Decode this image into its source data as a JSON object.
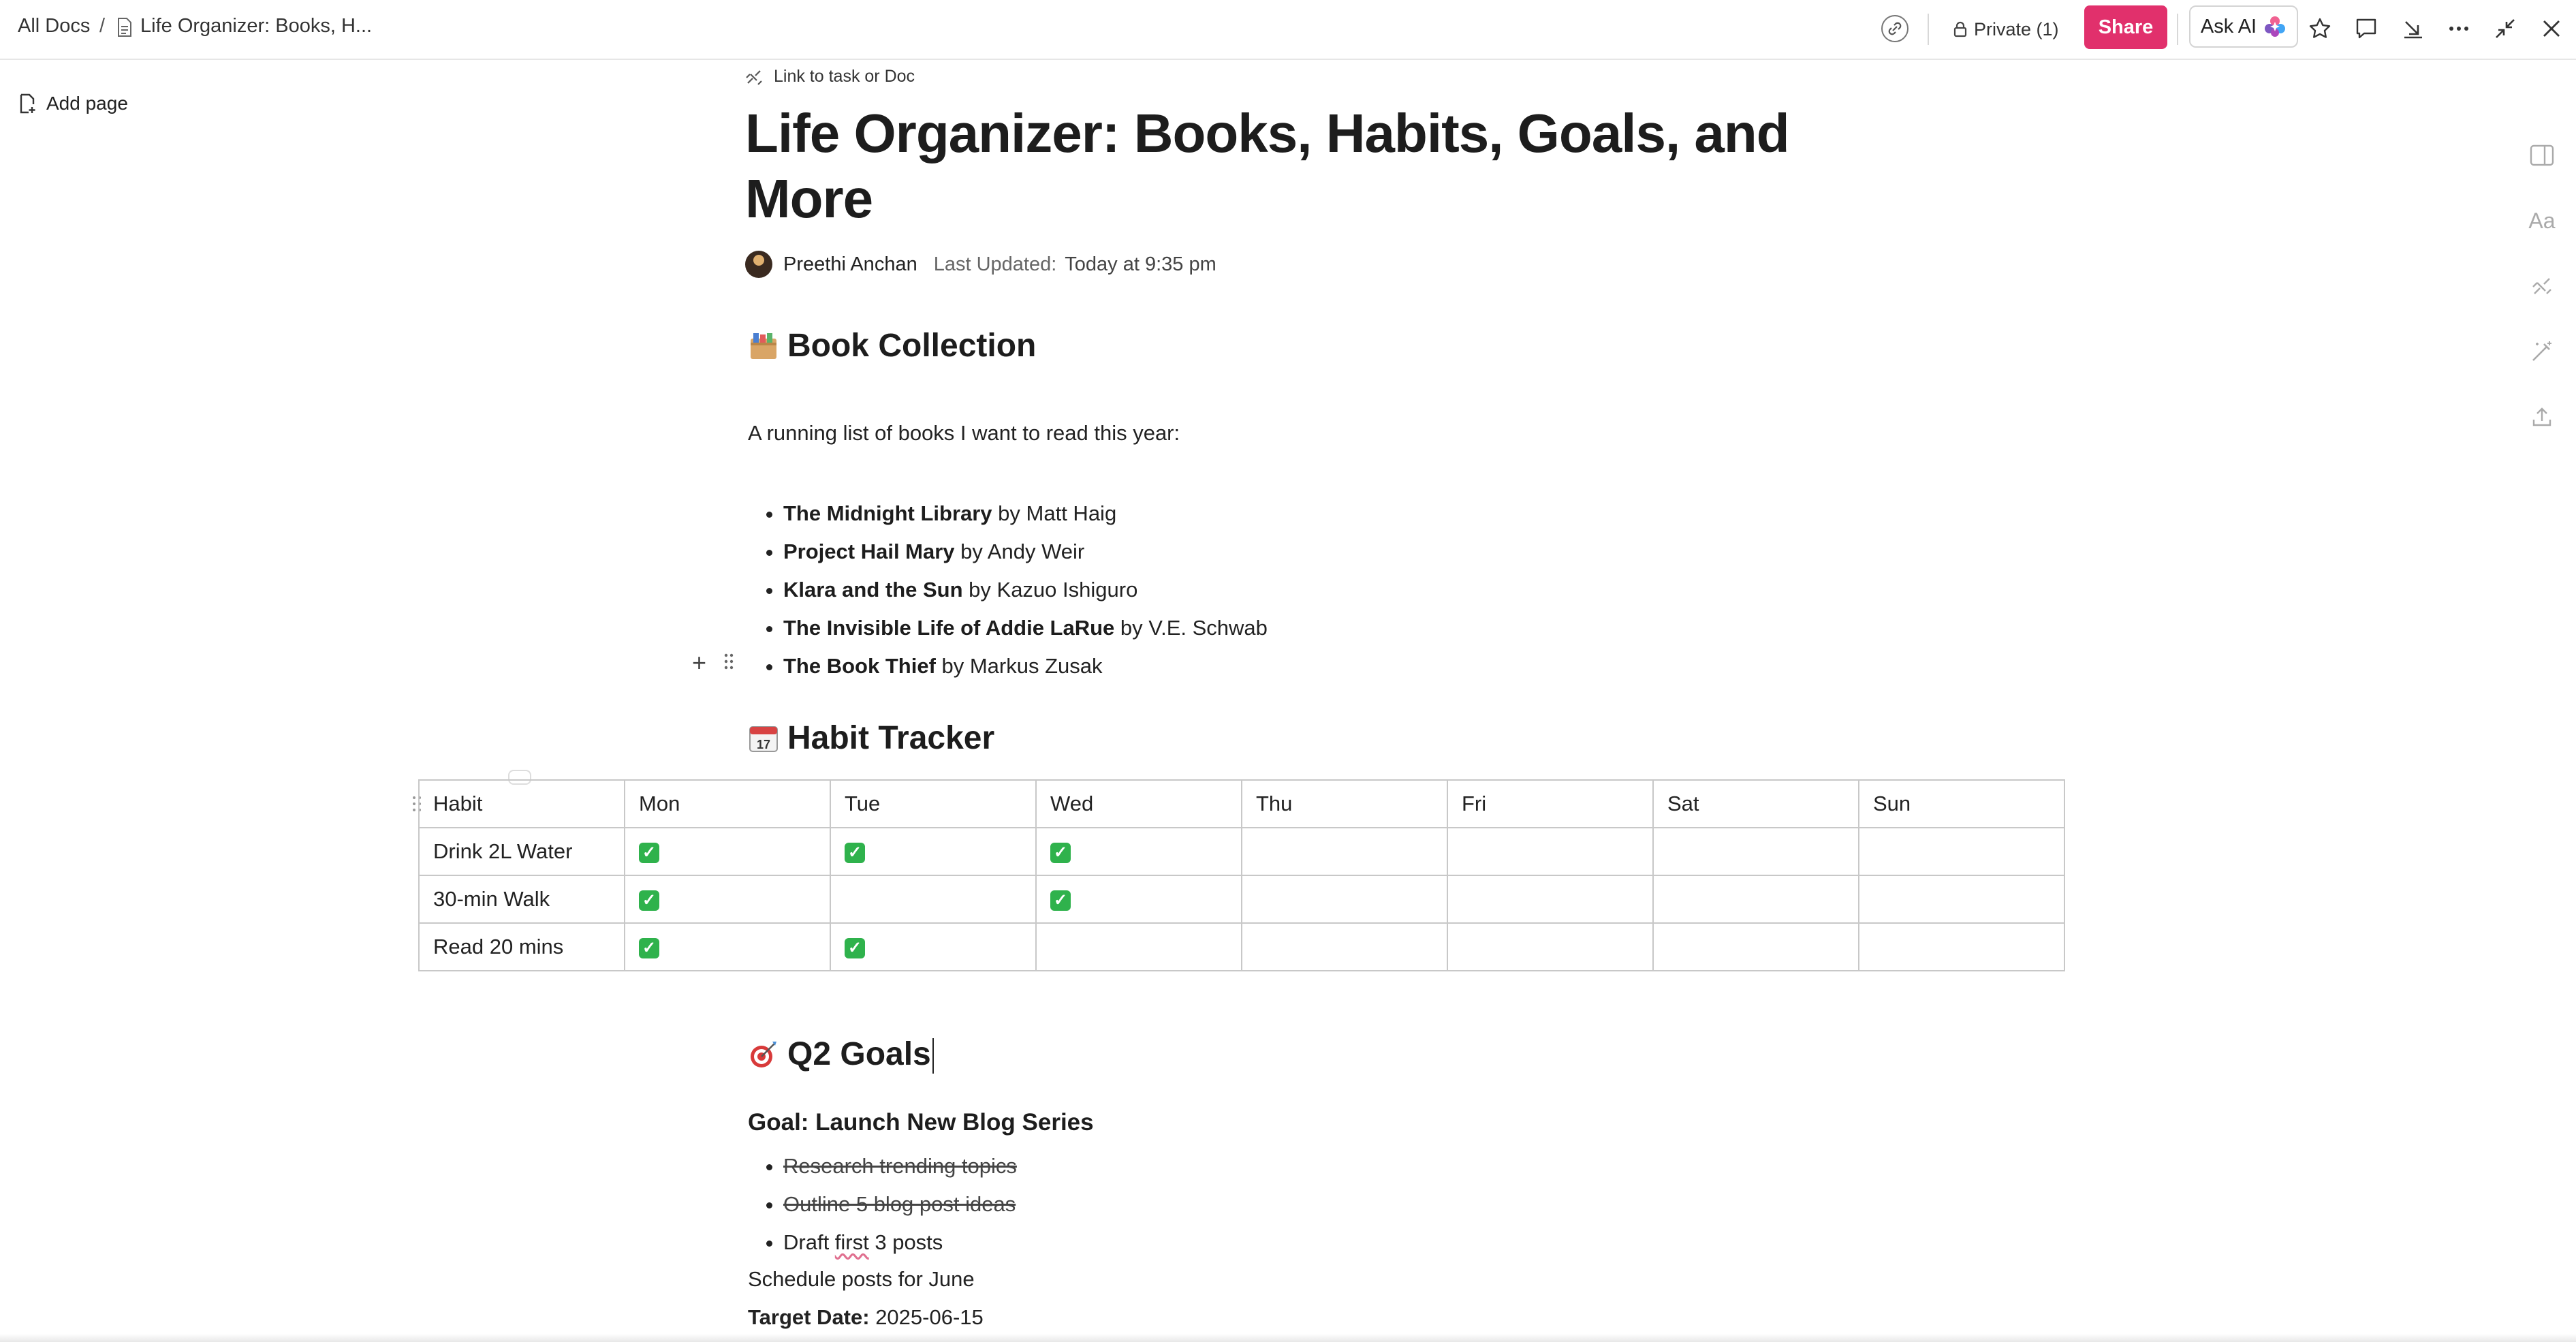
{
  "breadcrumb": {
    "root": "All Docs",
    "separator": "/",
    "doc": "Life Organizer: Books, H..."
  },
  "topbar": {
    "private_label": "Private (1)",
    "share_label": "Share",
    "ask_ai_label": "Ask AI",
    "icons": [
      "link-icon",
      "lock-icon",
      "sparkle-icon",
      "star-icon",
      "comment-icon",
      "download-icon",
      "more-icon",
      "collapse-icon",
      "close-icon"
    ],
    "colors": {
      "share": "#e1306c"
    }
  },
  "sidebar": {
    "add_page_label": "Add page"
  },
  "doc": {
    "link_task_label": "Link to task or Doc",
    "title": "Life Organizer: Books, Habits, Goals, and More",
    "author": "Preethi Anchan",
    "last_updated_label": "Last Updated:",
    "last_updated_value": "Today at 9:35 pm",
    "books": {
      "heading": "Book Collection",
      "intro": "A running list of books I want to read this year:",
      "items": [
        {
          "title": "The Midnight Library",
          "author": " by Matt Haig"
        },
        {
          "title": "Project Hail Mary",
          "author": " by Andy Weir"
        },
        {
          "title": "Klara and the Sun",
          "author": " by Kazuo Ishiguro"
        },
        {
          "title": "The Invisible Life of Addie LaRue",
          "author": " by V.E. Schwab"
        },
        {
          "title": "The Book Thief",
          "author": " by Markus Zusak"
        }
      ]
    },
    "habits": {
      "heading": "Habit Tracker",
      "columns": [
        "Habit",
        "Mon",
        "Tue",
        "Wed",
        "Thu",
        "Fri",
        "Sat",
        "Sun"
      ],
      "rows": [
        {
          "habit": "Drink 2L Water",
          "done": [
            true,
            true,
            true,
            false,
            false,
            false,
            false
          ]
        },
        {
          "habit": "30-min Walk",
          "done": [
            true,
            false,
            true,
            false,
            false,
            false,
            false
          ]
        },
        {
          "habit": "Read 20 mins",
          "done": [
            true,
            true,
            false,
            false,
            false,
            false,
            false
          ]
        }
      ]
    },
    "goals": {
      "heading": "Q2 Goals",
      "goal_title": "Goal: Launch New Blog Series",
      "tasks_done": [
        "Research trending topics",
        "Outline 5 blog post ideas"
      ],
      "task_open_prefix": "Draft ",
      "task_open_misspelled": "first",
      "task_open_suffix": " 3 posts",
      "schedule": "Schedule posts for June",
      "target_label": "Target Date:",
      "target_value": " 2025-06-15"
    }
  }
}
